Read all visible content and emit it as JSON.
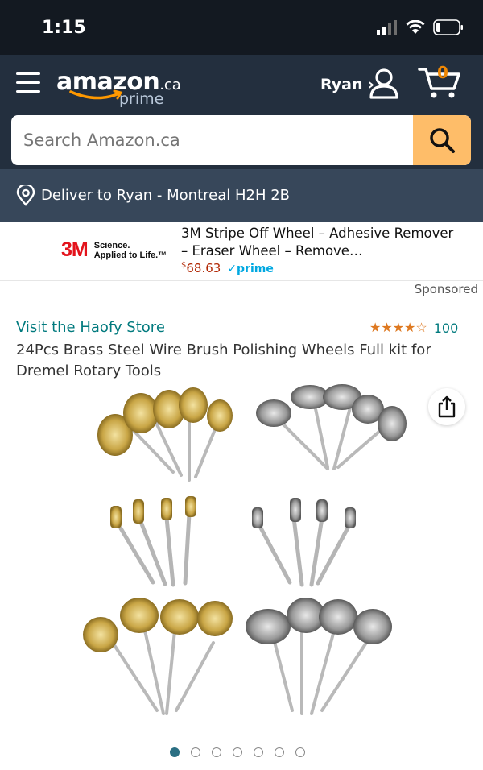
{
  "status": {
    "time": "1:15"
  },
  "header": {
    "logo_main": "amazon",
    "logo_domain": ".ca",
    "logo_sub": "prime",
    "account": "Ryan ›",
    "cart_count": "0"
  },
  "search": {
    "placeholder": "Search Amazon.ca"
  },
  "deliver": {
    "text": "Deliver to Ryan - Montreal H2H 2B"
  },
  "ad": {
    "brand": "3M",
    "tagline_1": "Science.",
    "tagline_2": "Applied to Life.™",
    "title": "3M Stripe Off Wheel – Adhesive Remover – Eraser Wheel – Remove…",
    "price_sup": "$",
    "price": "68.63",
    "prime": "✓prime"
  },
  "sponsored": "Sponsored",
  "product": {
    "store": "Visit the Haofy Store",
    "stars": "★★★★☆",
    "rating_value": 4.5,
    "rating_count": "100",
    "title": "24Pcs Brass Steel Wire Brush Polishing Wheels Full kit for Dremel Rotary Tools"
  },
  "carousel": {
    "total": 7,
    "active": 0
  },
  "colors": {
    "header": "#232f3e",
    "statusbar": "#131921",
    "deliver": "#37475a",
    "search_button": "#febd69",
    "link": "#017a7e",
    "price": "#b12704",
    "star": "#de7921"
  }
}
